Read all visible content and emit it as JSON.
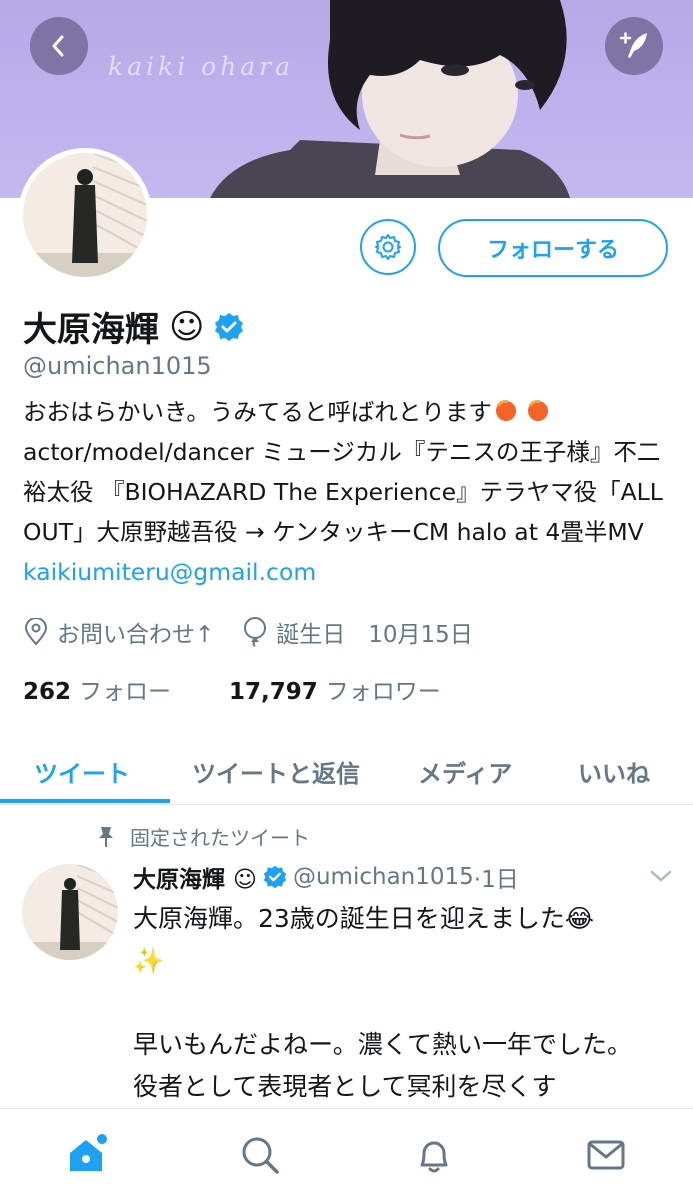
{
  "banner": {
    "name": "kaiki ohara"
  },
  "profile": {
    "display_name": "大原海輝",
    "smiley": "☺",
    "handle": "@umichan1015",
    "follow_label": "フォローする",
    "bio_line1": "おおはらかいき。うみてると呼ばれとります",
    "bio_rest": "actor/model/dancer ミュージカル『テニスの王子様』不二裕太役 『BIOHAZARD The Experience』テラヤマ役「ALL OUT」大原野越吾役 → ケンタッキーCM halo at 4畳半MV ",
    "bio_link": "kaikiumiteru@gmail.com",
    "location": "お問い合わせ↑",
    "birthday": "誕生日　10月15日",
    "following_count": "262",
    "following_label": "フォロー",
    "followers_count": "17,797",
    "followers_label": "フォロワー"
  },
  "tabs": [
    {
      "label": "ツイート"
    },
    {
      "label": "ツイートと返信"
    },
    {
      "label": "メディア"
    },
    {
      "label": "いいね"
    }
  ],
  "tweet": {
    "pinned_label": "固定されたツイート",
    "name": "大原海輝 ☺",
    "handle": "@umichan1015",
    "time": "·1日",
    "line1": "大原海輝。23歳の誕生日を迎えました😂",
    "line2": "✨",
    "line3": "早いもんだよねー。濃くて熱い一年でした。",
    "line4": "役者として表現者として冥利を尽くす"
  },
  "colors": {
    "accent": "#1da1f2",
    "muted": "#657786",
    "banner": "#b7a9e8"
  },
  "icons": [
    "back-icon",
    "compose-icon",
    "gear-icon",
    "verified-icon",
    "location-icon",
    "balloon-icon",
    "pin-icon",
    "chevron-down-icon",
    "home-icon",
    "search-icon",
    "bell-icon",
    "mail-icon"
  ]
}
